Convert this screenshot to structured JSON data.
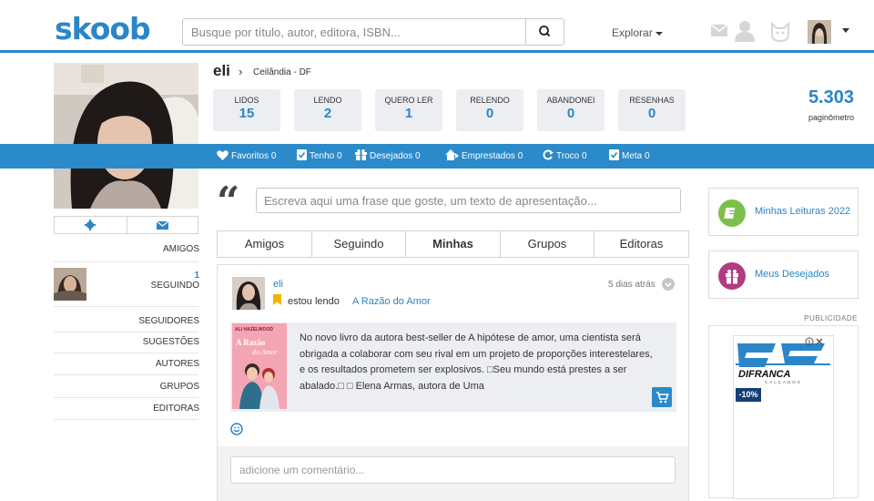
{
  "header": {
    "logo": "skoob",
    "search_placeholder": "Busque por título, autor, editora, ISBN...",
    "explore_label": "Explorar"
  },
  "profile": {
    "name": "eli",
    "location": "Ceilândia - DF",
    "stats": [
      {
        "label": "LIDOS",
        "value": "15"
      },
      {
        "label": "LENDO",
        "value": "2"
      },
      {
        "label": "QUERO LER",
        "value": "1"
      },
      {
        "label": "RELENDO",
        "value": "0"
      },
      {
        "label": "ABANDONEI",
        "value": "0"
      },
      {
        "label": "RESENHAS",
        "value": "0"
      }
    ],
    "pages_value": "5.303",
    "pages_label": "paginômetro"
  },
  "blue_bar": {
    "items": [
      {
        "icon": "heart-icon",
        "label": "Favoritos 0"
      },
      {
        "icon": "check-icon",
        "label": "Tenho 0"
      },
      {
        "icon": "gift-icon",
        "label": "Desejados 0"
      },
      {
        "icon": "lend-icon",
        "label": "Emprestados 0"
      },
      {
        "icon": "swap-icon",
        "label": "Troco 0"
      },
      {
        "icon": "check-icon",
        "label": "Meta 0"
      }
    ]
  },
  "sidebar": {
    "amigos": "AMIGOS",
    "seguindo_count": "1",
    "seguindo_label": "SEGUINDO",
    "links": [
      "SEGUIDORES",
      "SUGESTÕES",
      "AUTORES",
      "GRUPOS",
      "EDITORAS"
    ]
  },
  "quote": {
    "mark": "“",
    "placeholder": "Escreva aqui uma frase que goste, um texto de apresentação..."
  },
  "tabs": [
    "Amigos",
    "Seguindo",
    "Minhas",
    "Grupos",
    "Editoras"
  ],
  "feed": {
    "user": "eli",
    "time": "5 dias atrás",
    "status": "estou lendo",
    "book_title": "A Razão do Amor",
    "cover_author": "ALI HAZELWOOD",
    "cover_title_1": "A Razão",
    "cover_title_2": "do Amor",
    "description": "No novo livro da autora best-seller de A hipótese de amor, uma cientista será obrigada a colaborar com seu rival em um projeto de proporções interestelares, e os resultados prometem ser explosivos. □Seu mundo está prestes a ser abalado.□ □ Elena Armas, autora de Uma",
    "comment_placeholder": "adicione um comentário..."
  },
  "right": {
    "card1": "Minhas Leituras 2022",
    "card2": "Meus Desejados",
    "ad_label": "PUBLICIDADE",
    "ad_brand": "DIFRANCA",
    "ad_sub": "CALÇADOS",
    "ad_badge": "-10%"
  },
  "colors": {
    "brand_blue": "#2b8ac9",
    "green": "#7cc04b",
    "magenta": "#b23b82"
  }
}
